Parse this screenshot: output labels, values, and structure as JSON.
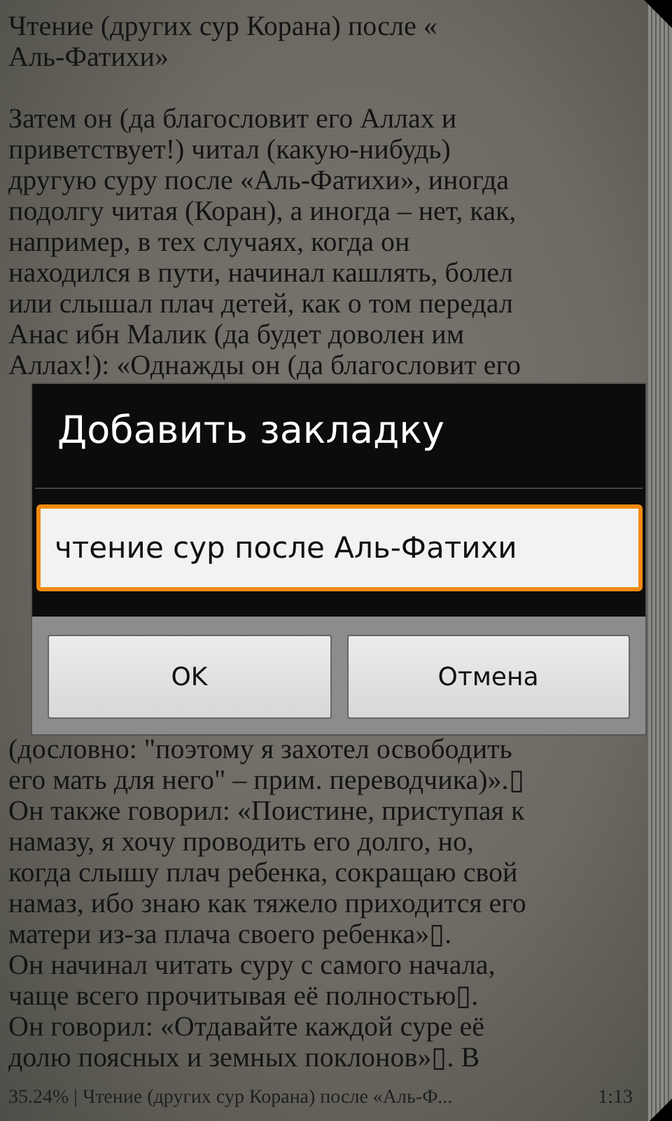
{
  "book_page": {
    "heading_lines": [
      "Чтение (других сур Корана) после «",
      "Аль-Фатихи»"
    ],
    "body_lines_top": [
      "Затем он (да благословит его Аллах и",
      "приветствует!) читал (какую-нибудь)",
      "другую суру после «Аль-Фатихи», иногда",
      "подолгу читая (Коран), а иногда – нет, как,",
      "например, в тех случаях, когда он",
      "находился в пути, начинал кашлять, болел",
      "или слышал плач детей, как о том передал",
      "Анас ибн Малик (да будет доволен им",
      "Аллах!): «Однажды он (да благословит его"
    ],
    "body_lines_bottom": [
      "(дословно: \"поэтому я захотел освободить",
      "его мать для него\" – прим. переводчика)».▯",
      "Он также говорил: «Поистине, приступая к",
      "намазу, я хочу проводить его долго, но,",
      "когда слышу плач ребенка, сокращаю свой",
      "намаз, ибо знаю как тяжело приходится его",
      "матери из-за плача своего ребенка»▯.",
      "Он начинал читать суру с самого начала,",
      "чаще всего прочитывая её полностью▯.",
      "Он говорил: «Отдавайте каждой суре её",
      "долю поясных и земных поклонов»▯. В"
    ]
  },
  "dialog": {
    "title": "Добавить закладку",
    "input": {
      "value": "чтение сур после Аль-Фатихи",
      "focused": true
    },
    "buttons": [
      {
        "label": "OK"
      },
      {
        "label": "Отмена"
      }
    ]
  },
  "status_bar": {
    "position": "35.24% | Чтение (других сур Корана) после «Аль-Ф...",
    "time": "1:13"
  }
}
